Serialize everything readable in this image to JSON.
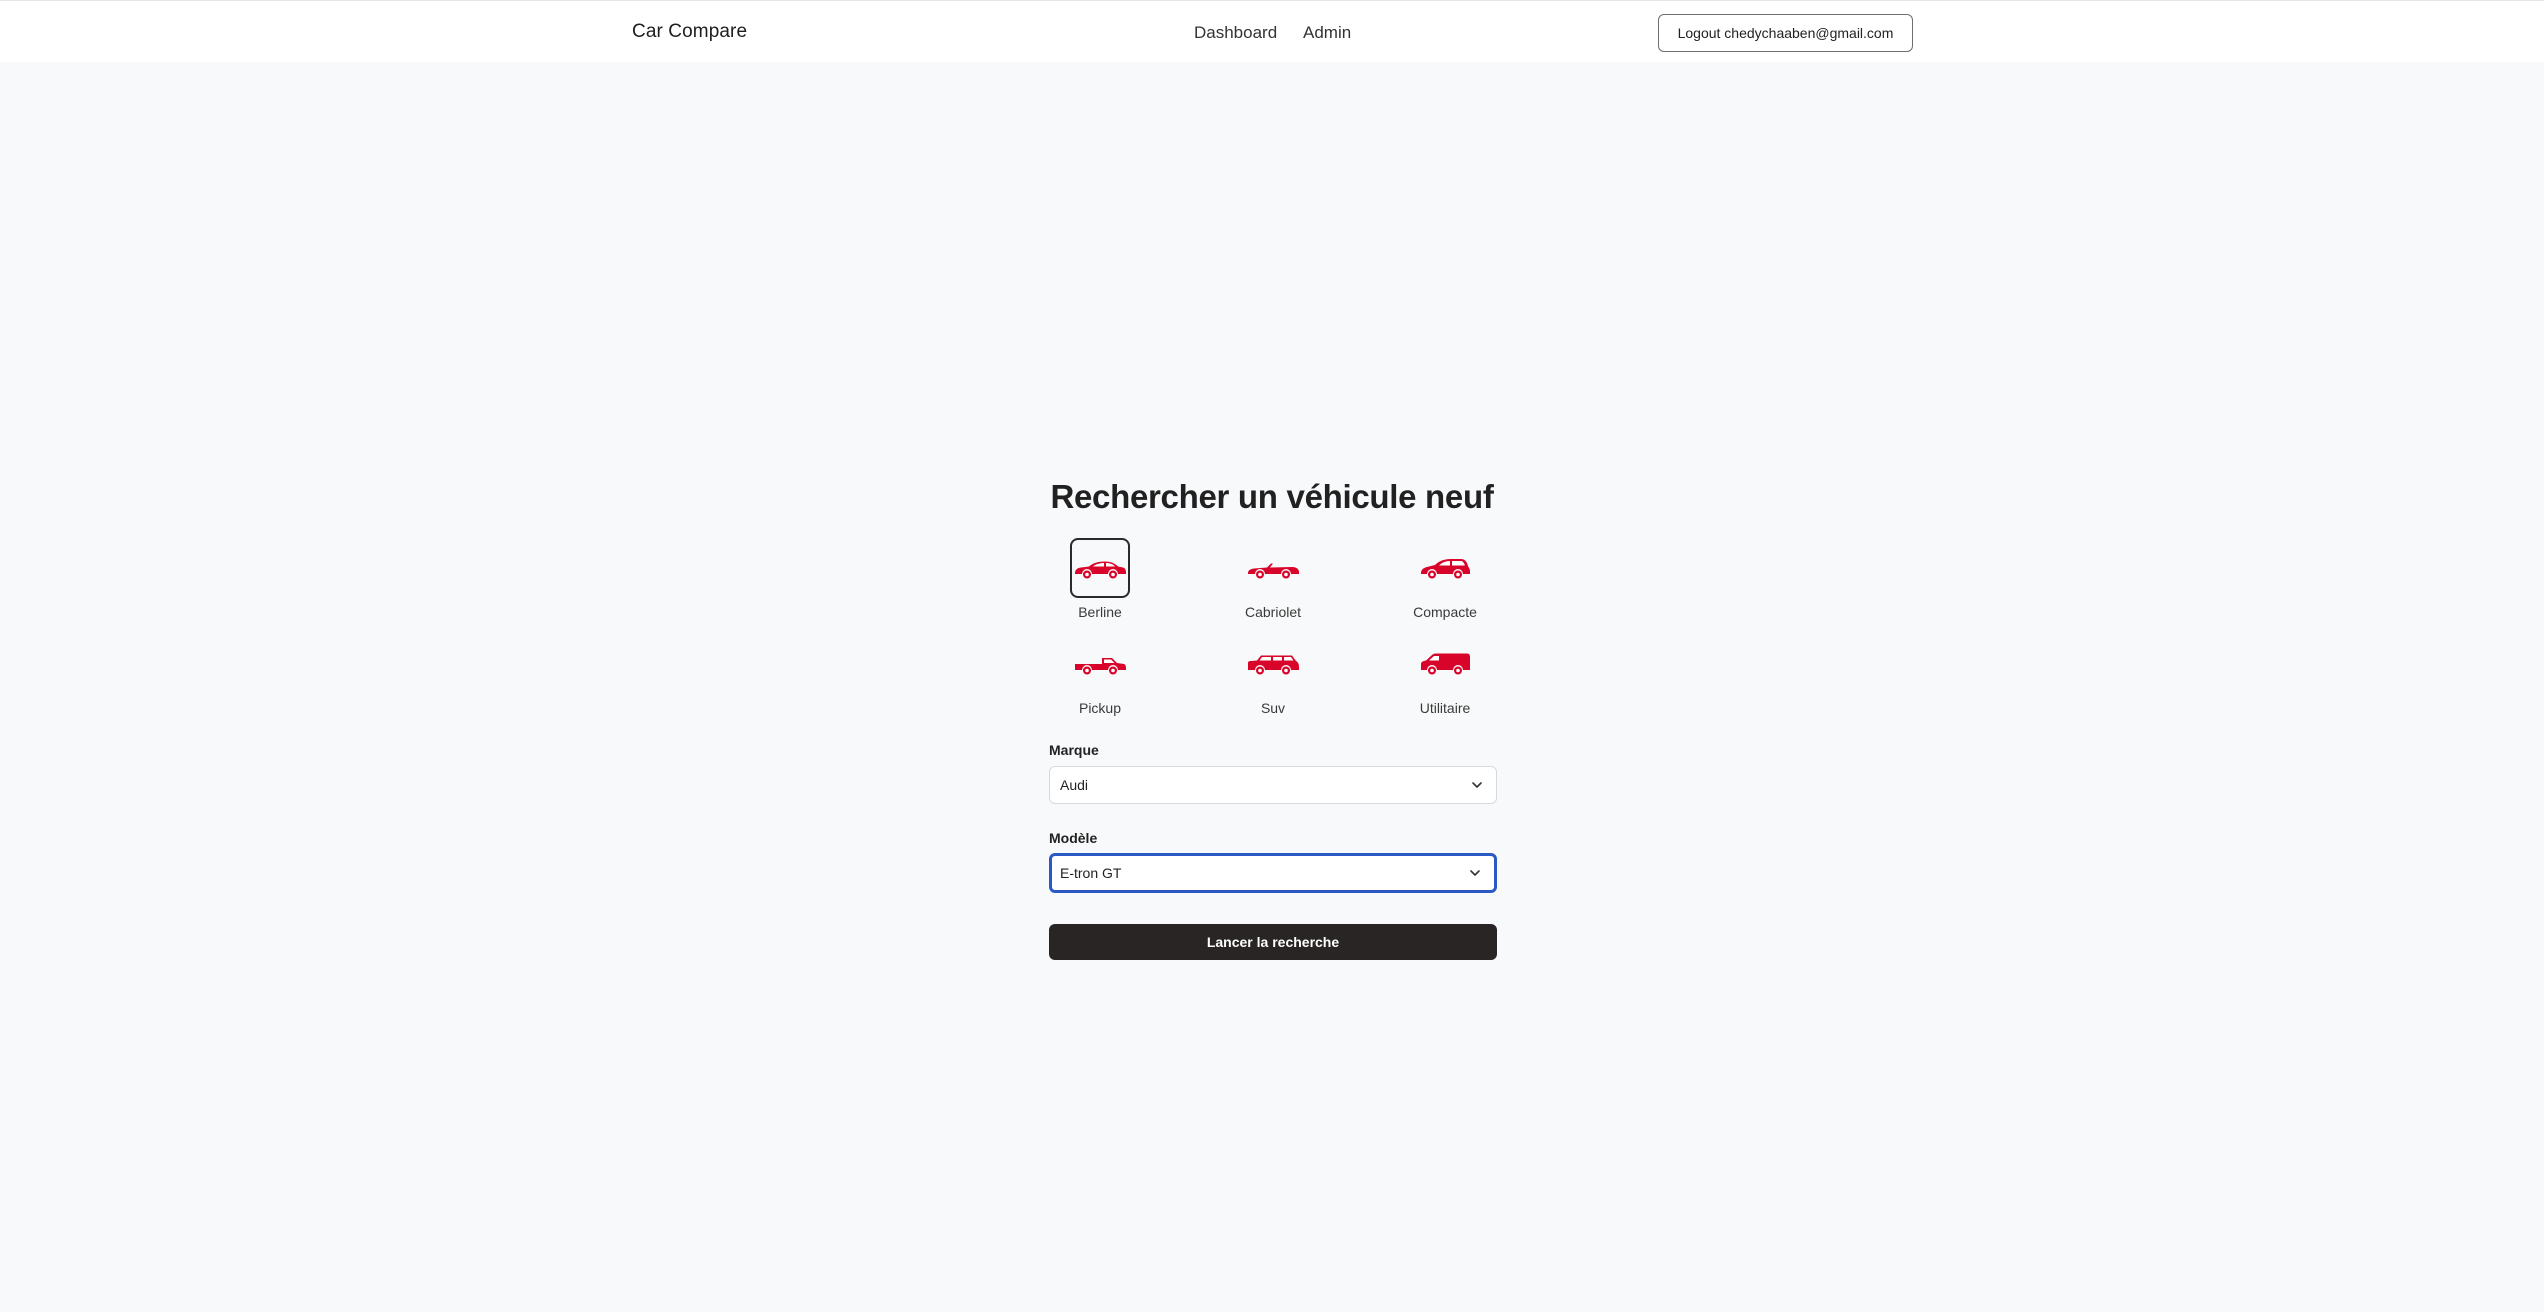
{
  "navbar": {
    "brand": "Car Compare",
    "links": [
      "Dashboard",
      "Admin"
    ],
    "logout_label": "Logout chedychaaben@gmail.com"
  },
  "search": {
    "title": "Rechercher un véhicule neuf",
    "vehicle_types": [
      {
        "label": "Berline",
        "icon": "sedan-icon",
        "selected": true
      },
      {
        "label": "Cabriolet",
        "icon": "convertible-icon",
        "selected": false
      },
      {
        "label": "Compacte",
        "icon": "hatchback-icon",
        "selected": false
      },
      {
        "label": "Pickup",
        "icon": "pickup-icon",
        "selected": false
      },
      {
        "label": "Suv",
        "icon": "suv-icon",
        "selected": false
      },
      {
        "label": "Utilitaire",
        "icon": "van-icon",
        "selected": false
      }
    ],
    "brand_label": "Marque",
    "brand_value": "Audi",
    "model_label": "Modèle",
    "model_value": "E-tron GT",
    "submit_label": "Lancer la recherche"
  },
  "colors": {
    "accent_red": "#d90429",
    "button_dark": "#282524",
    "focus_blue": "#2b59c3",
    "background": "#f8f9fa"
  }
}
